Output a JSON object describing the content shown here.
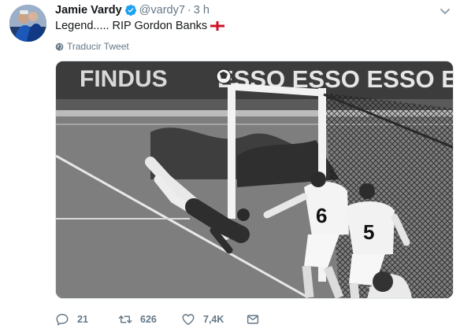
{
  "tweet": {
    "author_name": "Jamie Vardy",
    "author_handle": "@vardy7",
    "separator": "·",
    "time": "3 h",
    "text": "Legend..... RIP Gordon Banks",
    "translate_label": "Traducir Tweet",
    "photo": {
      "billboard_text_left": "FINDUS",
      "billboard_text_right": "ESSO ESSO ESSO ESSO",
      "shirt_numbers": [
        "6",
        "5"
      ]
    }
  },
  "actions": {
    "replies": "21",
    "retweets": "626",
    "likes": "7,4K"
  },
  "colors": {
    "verified": "#1da1f2",
    "muted": "#657786",
    "text": "#14171a"
  },
  "icons": {
    "avatar": "avatar",
    "verified": "verified-badge-icon",
    "menu": "chevron-down-icon",
    "flag": "england-flag-icon",
    "translate": "globe-icon",
    "reply": "reply-icon",
    "retweet": "retweet-icon",
    "like": "heart-icon",
    "dm": "envelope-icon"
  }
}
